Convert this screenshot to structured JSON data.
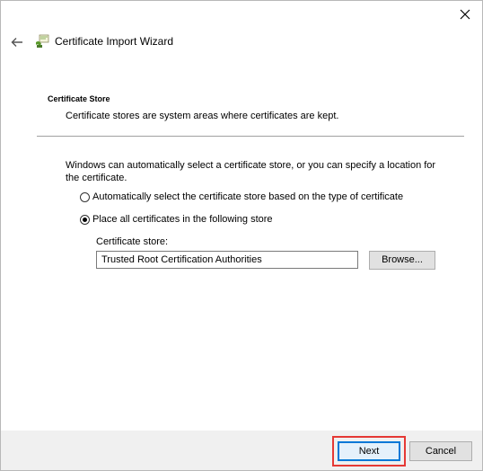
{
  "window": {
    "close_icon": "close-icon",
    "back_icon": "back-arrow-icon",
    "title_icon": "certificate-wizard-icon",
    "title": "Certificate Import Wizard"
  },
  "header": {
    "section_title": "Certificate Store",
    "section_description": "Certificate stores are system areas where certificates are kept."
  },
  "content": {
    "intro": "Windows can automatically select a certificate store, or you can specify a location for the certificate.",
    "options": [
      {
        "label": "Automatically select the certificate store based on the type of certificate",
        "selected": false
      },
      {
        "label": "Place all certificates in the following store",
        "selected": true
      }
    ],
    "store_label": "Certificate store:",
    "store_value": "Trusted Root Certification Authorities",
    "browse_label": "Browse..."
  },
  "footer": {
    "next_label": "Next",
    "cancel_label": "Cancel"
  },
  "colors": {
    "highlight": "#e53935",
    "focus": "#0078d7",
    "footer_bg": "#f0f0f0"
  }
}
